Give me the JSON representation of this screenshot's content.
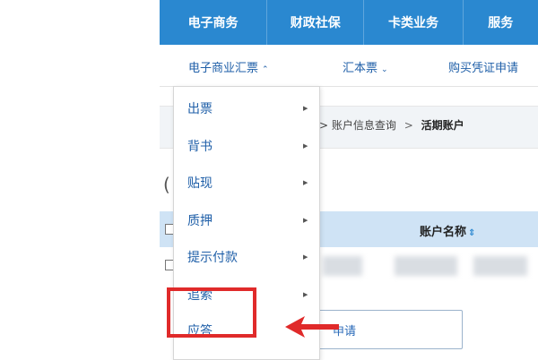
{
  "topnav": {
    "items": [
      "电子商务",
      "财政社保",
      "卡类业务",
      "服务"
    ]
  },
  "subnav": {
    "items": [
      {
        "label": "电子商业汇票",
        "chevron": "^"
      },
      {
        "label": "汇本票",
        "chevron": "v"
      },
      {
        "label": "购买凭证申请"
      }
    ]
  },
  "breadcrumb": {
    "sep": ">",
    "parent": "账户信息查询",
    "current": "活期账户"
  },
  "table": {
    "col_name": "账户名称",
    "sort_icon": "sort-icon"
  },
  "request_field": {
    "text": "申请"
  },
  "dropdown": {
    "items": [
      {
        "label": "出票",
        "submenu": true
      },
      {
        "label": "背书",
        "submenu": true
      },
      {
        "label": "贴现",
        "submenu": true
      },
      {
        "label": "质押",
        "submenu": true
      },
      {
        "label": "提示付款",
        "submenu": true
      },
      {
        "label": "追索",
        "submenu": true
      },
      {
        "label": "应答",
        "submenu": false
      }
    ]
  },
  "colors": {
    "nav_blue": "#2a88d0",
    "header_blue": "#cfe3f5",
    "highlight_red": "#e02a2a"
  }
}
